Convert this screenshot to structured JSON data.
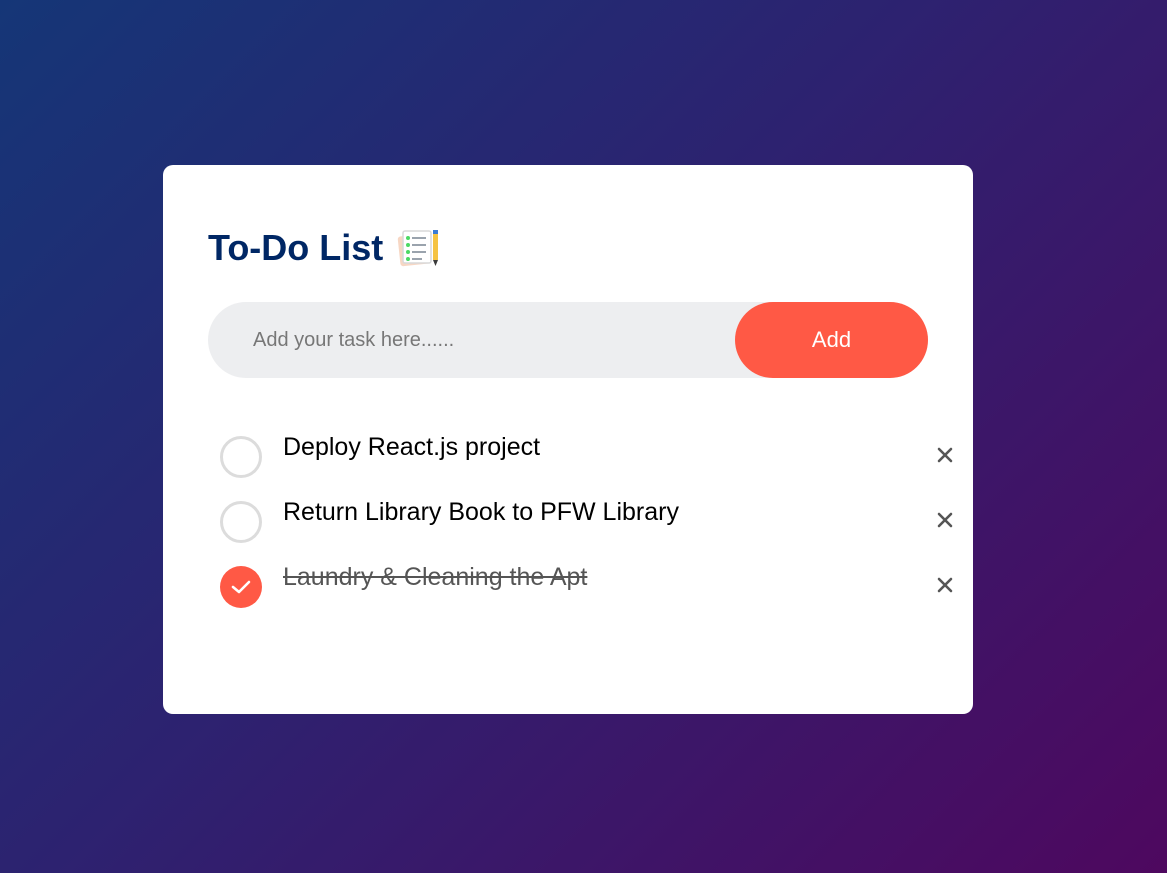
{
  "app": {
    "title": "To-Do List",
    "title_icon": "notepad-checklist-icon"
  },
  "input": {
    "placeholder": "Add your task here......",
    "value": ""
  },
  "add_button": {
    "label": "Add"
  },
  "colors": {
    "accent": "#ff5945",
    "title": "#002765",
    "input_bg": "#edeef0",
    "bg_gradient_start": "#153677",
    "bg_gradient_end": "#4e085f"
  },
  "tasks": [
    {
      "text": "Deploy React.js project",
      "completed": false
    },
    {
      "text": "Return Library Book to PFW Library",
      "completed": false
    },
    {
      "text": "Laundry & Cleaning the Apt",
      "completed": true
    }
  ]
}
